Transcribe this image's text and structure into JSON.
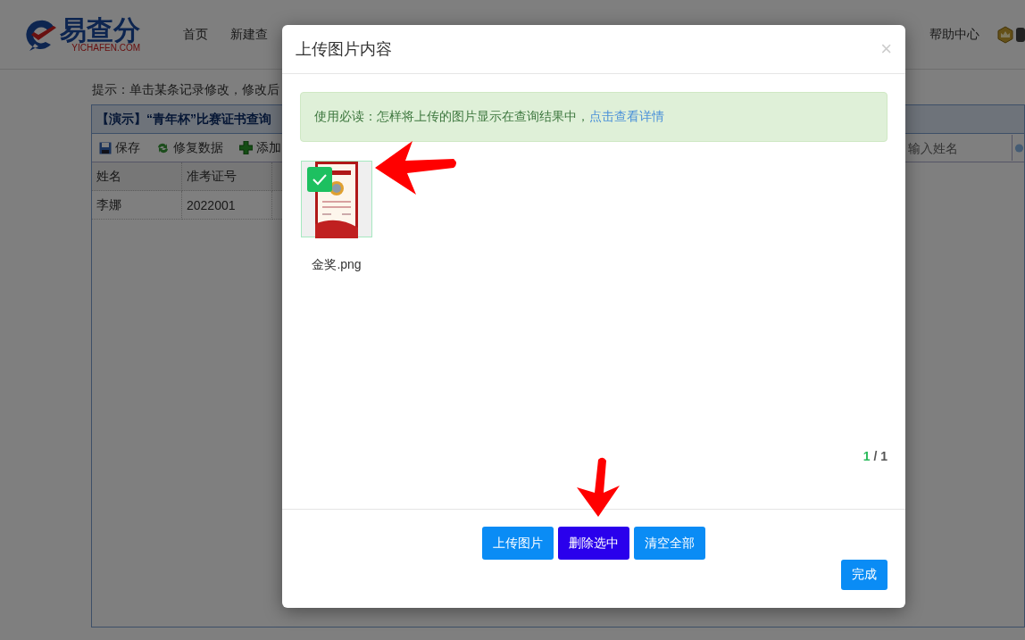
{
  "header": {
    "logo": {
      "name": "易查分",
      "domain": "YICHAFEN.COM"
    },
    "nav": [
      "首页",
      "新建查",
      "帮助中心"
    ]
  },
  "hint": "提示：单击某条记录修改，修改后",
  "panel": {
    "title": "【演示】“青年杯”比赛证书查询",
    "toolbar": [
      {
        "kind": "save",
        "label": "保存"
      },
      {
        "kind": "repair",
        "label": "修复数据"
      },
      {
        "kind": "add",
        "label": "添加"
      }
    ],
    "search": {
      "placeholder": "输入姓名"
    },
    "table": {
      "columns": [
        "姓名",
        "准考证号"
      ],
      "rows": [
        [
          "李娜",
          "2022001"
        ]
      ]
    }
  },
  "dialog": {
    "title": "上传图片内容",
    "close": "×",
    "notice": {
      "text": "使用必读：怎样将上传的图片显示在查询结果中，",
      "link": "点击查看详情"
    },
    "images": [
      {
        "kind": "picture",
        "name": "金奖.png",
        "selected": true
      }
    ],
    "pager": {
      "current": "1",
      "total": "/ 1"
    },
    "buttons": [
      {
        "label": "上传图片",
        "selected": false
      },
      {
        "label": "删除选中",
        "selected": true
      },
      {
        "label": "清空全部",
        "selected": false
      }
    ],
    "done": "完成"
  }
}
